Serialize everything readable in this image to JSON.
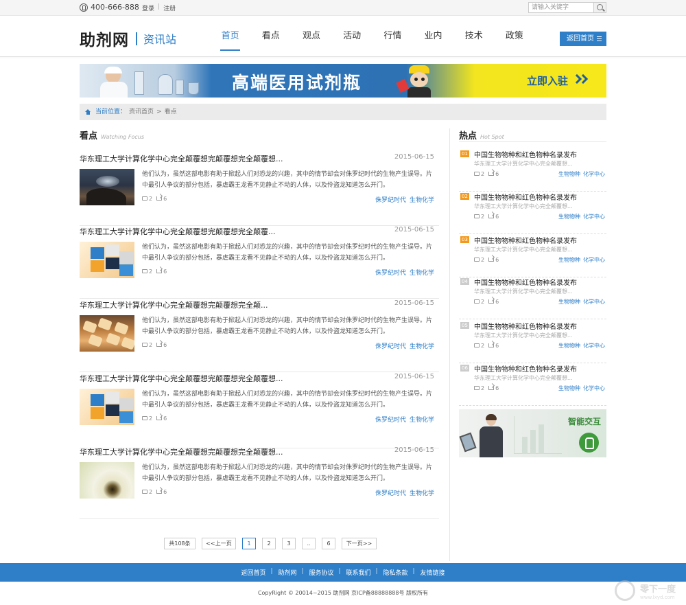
{
  "topbar": {
    "phone": "400-666-888",
    "login": "登录",
    "register": "注册",
    "auth_sep": "|",
    "search_placeholder": "请输入关键字"
  },
  "header": {
    "logo": "助剂网",
    "subtitle": "资讯站",
    "nav": [
      "首页",
      "看点",
      "观点",
      "活动",
      "行情",
      "业内",
      "技术",
      "政策"
    ],
    "active_nav": "首页",
    "back_home": "返回首页"
  },
  "banner": {
    "headline": "高端医用试剂瓶",
    "cta": "立即入驻"
  },
  "breadcrumb": {
    "label": "当前位置：",
    "home": "资讯首页",
    "sep": ">",
    "current": "看点"
  },
  "main": {
    "title": "看点",
    "title_en": "Watching Focus",
    "articles": [
      {
        "title": "华东理工大学计算化学中心完全颠覆想完颠覆想完全颠覆想...",
        "date": "2015-06-15",
        "thumb": "dinosaur-image",
        "summary": "他们认为，虽然这部电影有助于掀起人们对恐龙的兴趣，其中的情节却会对侏罗纪时代的生物产生误导。片中最引人争议的部分包括，暴虐霸王龙看不见静止不动的人体，以及伶盗龙知道怎么开门。",
        "comments": "2",
        "shares": "6",
        "tags": [
          "侏罗纪时代",
          "生物化学"
        ]
      },
      {
        "title": "华东理工大学计算化学中心完全颠覆想完颠覆想完全颠覆...",
        "date": "2015-06-15",
        "thumb": "cube-image",
        "summary": "他们认为，虽然这部电影有助于掀起人们对恐龙的兴趣，其中的情节却会对侏罗纪时代的生物产生误导。片中最引人争议的部分包括，暴虐霸王龙看不见静止不动的人体，以及伶盗龙知道怎么开门。",
        "comments": "2",
        "shares": "6",
        "tags": [
          "侏罗纪时代",
          "生物化学"
        ]
      },
      {
        "title": "华东理工大学计算化学中心完全颠覆想完颠覆想完全颠...",
        "date": "2015-06-15",
        "thumb": "bread-image",
        "summary": "他们认为，虽然这部电影有助于掀起人们对恐龙的兴趣，其中的情节却会对侏罗纪时代的生物产生误导。片中最引人争议的部分包括，暴虐霸王龙看不见静止不动的人体，以及伶盗龙知道怎么开门。",
        "comments": "2",
        "shares": "6",
        "tags": [
          "侏罗纪时代",
          "生物化学"
        ]
      },
      {
        "title": "华东理工大学计算化学中心完全颠覆想完颠覆想完全颠覆想...",
        "date": "2015-06-15",
        "thumb": "cube-image",
        "summary": "他们认为，虽然这部电影有助于掀起人们对恐龙的兴趣，其中的情节却会对侏罗纪时代的生物产生误导。片中最引人争议的部分包括，暴虐霸王龙看不见静止不动的人体，以及伶盗龙知道怎么开门。",
        "comments": "2",
        "shares": "6",
        "tags": [
          "侏罗纪时代",
          "生物化学"
        ]
      },
      {
        "title": "华东理工大学计算化学中心完全颠覆想完颠覆想完全颠覆想...",
        "date": "2015-06-15",
        "thumb": "dandelion-image",
        "summary": "他们认为，虽然这部电影有助于掀起人们对恐龙的兴趣，其中的情节却会对侏罗纪时代的生物产生误导。片中最引人争议的部分包括，暴虐霸王龙看不见静止不动的人体，以及伶盗龙知道怎么开门。",
        "comments": "2",
        "shares": "6",
        "tags": [
          "侏罗纪时代",
          "生物化学"
        ]
      }
    ]
  },
  "side": {
    "title": "热点",
    "title_en": "Hot Spot",
    "items": [
      {
        "num": "01",
        "title": "中国生物物种和红色物种名录发布",
        "sub": "华东理工大学计算化学中心完全颠覆想...",
        "comments": "2",
        "shares": "6",
        "tags": [
          "生物物种",
          "化学中心"
        ]
      },
      {
        "num": "02",
        "title": "中国生物物种和红色物种名录发布",
        "sub": "华东理工大学计算化学中心完全颠覆想...",
        "comments": "2",
        "shares": "6",
        "tags": [
          "生物物种",
          "化学中心"
        ]
      },
      {
        "num": "03",
        "title": "中国生物物种和红色物种名录发布",
        "sub": "华东理工大学计算化学中心完全颠覆想...",
        "comments": "2",
        "shares": "6",
        "tags": [
          "生物物种",
          "化学中心"
        ]
      },
      {
        "num": "04",
        "title": "中国生物物种和红色物种名录发布",
        "sub": "华东理工大学计算化学中心完全颠覆想...",
        "comments": "2",
        "shares": "6",
        "tags": [
          "生物物种",
          "化学中心"
        ]
      },
      {
        "num": "05",
        "title": "中国生物物种和红色物种名录发布",
        "sub": "华东理工大学计算化学中心完全颠覆想...",
        "comments": "2",
        "shares": "6",
        "tags": [
          "生物物种",
          "化学中心"
        ]
      },
      {
        "num": "06",
        "title": "中国生物物种和红色物种名录发布",
        "sub": "华东理工大学计算化学中心完全颠覆想...",
        "comments": "2",
        "shares": "6",
        "tags": [
          "生物物种",
          "化学中心"
        ]
      }
    ],
    "ad_label": "智能交互"
  },
  "pagination": {
    "total": "共108条",
    "prev": "<<上一页",
    "pages": [
      "1",
      "2",
      "3",
      "..",
      "6"
    ],
    "current": "1",
    "next": "下一页>>"
  },
  "footer": {
    "links": [
      "返回首页",
      "助剂网",
      "服务协议",
      "联系我们",
      "隐私条款",
      "友情链接"
    ],
    "copyright": "CopyRight © 20014~2015 助剂网 京ICP备88888888号 版权所有"
  },
  "watermark": {
    "text": "零下一度",
    "url": "www.lxyd.com"
  },
  "colors": {
    "accent": "#2f7fc8",
    "hot_rank": "#f39a1e",
    "banner_yellow": "#f6e81a"
  }
}
